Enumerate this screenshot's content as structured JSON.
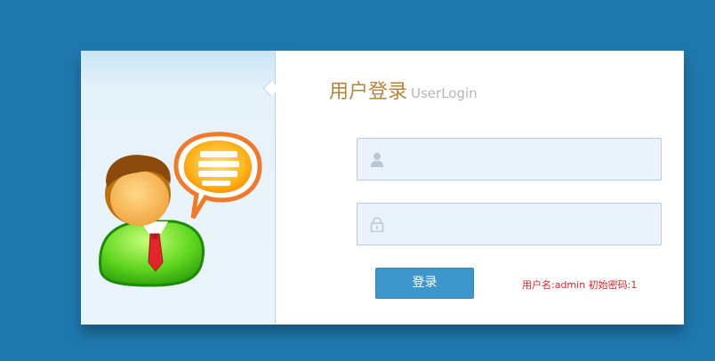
{
  "login": {
    "title": "用户登录",
    "subtitle": "UserLogin",
    "username": {
      "value": "",
      "placeholder": "",
      "icon": "user-icon"
    },
    "password": {
      "value": "",
      "placeholder": "",
      "icon": "lock-icon"
    },
    "submit_label": "登录",
    "hint": "用户名:admin 初始密码:1"
  },
  "illustration": {
    "icon": "user-with-speech-bubble-icon"
  },
  "colors": {
    "background": "#1f78ad",
    "title": "#b5843a",
    "subtitle": "#b5b5b5",
    "button": "#3d97cc",
    "hint": "#d9262c",
    "field_bg": "#eaf3fb"
  }
}
